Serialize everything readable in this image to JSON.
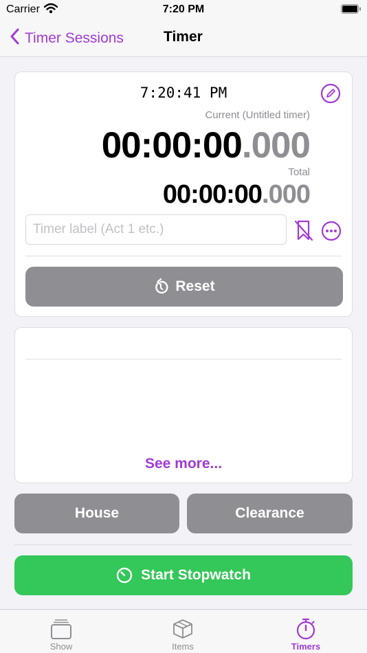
{
  "status_bar": {
    "carrier": "Carrier",
    "time": "7:20 PM"
  },
  "nav": {
    "back_label": "Timer Sessions",
    "title": "Timer"
  },
  "timer": {
    "clock": "7:20:41 PM",
    "current_caption": "Current (Untitled timer)",
    "current_main": "00:00:00",
    "current_frac": ".000",
    "total_caption": "Total",
    "total_main": "00:00:00",
    "total_frac": ".000",
    "label_placeholder": "Timer label (Act 1 etc.)",
    "label_value": "",
    "reset_label": "Reset"
  },
  "sessions": {
    "see_more": "See more..."
  },
  "actions": {
    "house": "House",
    "clearance": "Clearance",
    "start": "Start Stopwatch"
  },
  "tabs": [
    {
      "label": "Show",
      "icon": "stack-icon",
      "active": false
    },
    {
      "label": "Items",
      "icon": "box-icon",
      "active": false
    },
    {
      "label": "Timers",
      "icon": "stopwatch-icon",
      "active": true
    }
  ],
  "colors": {
    "accent": "#a23ad6",
    "start": "#34c759",
    "neutral_button": "#8e8e93"
  }
}
